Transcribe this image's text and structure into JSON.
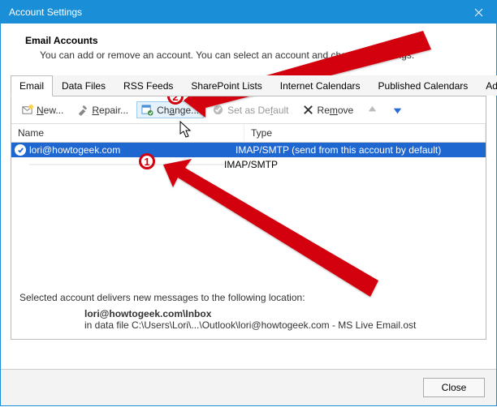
{
  "window": {
    "title": "Account Settings"
  },
  "header": {
    "heading": "Email Accounts",
    "sub": "You can add or remove an account. You can select an account and change its settings."
  },
  "tabs": [
    {
      "label": "Email"
    },
    {
      "label": "Data Files"
    },
    {
      "label": "RSS Feeds"
    },
    {
      "label": "SharePoint Lists"
    },
    {
      "label": "Internet Calendars"
    },
    {
      "label": "Published Calendars"
    },
    {
      "label": "Address Books"
    }
  ],
  "toolbar": {
    "new": {
      "pre": "",
      "u": "N",
      "post": "ew..."
    },
    "repair": {
      "pre": "",
      "u": "R",
      "post": "epair..."
    },
    "change": {
      "pre": "Ch",
      "u": "a",
      "post": "nge..."
    },
    "default": {
      "pre": "Set as De",
      "u": "f",
      "post": "ault"
    },
    "remove": {
      "pre": "Re",
      "u": "m",
      "post": "ove"
    }
  },
  "columns": {
    "name": "Name",
    "type": "Type"
  },
  "accounts": [
    {
      "name": "lori@howtogeek.com",
      "type": "IMAP/SMTP (send from this account by default)",
      "selected": true,
      "default": true
    },
    {
      "name": "",
      "type": "IMAP/SMTP",
      "selected": false,
      "default": false
    }
  ],
  "footer": {
    "intro": "Selected account delivers new messages to the following location:",
    "loc_bold": "lori@howtogeek.com\\Inbox",
    "loc_path": "in data file C:\\Users\\Lori\\...\\Outlook\\lori@howtogeek.com - MS Live Email.ost"
  },
  "buttons": {
    "close": "Close"
  },
  "annotations": {
    "step1": "1",
    "step2": "2"
  }
}
